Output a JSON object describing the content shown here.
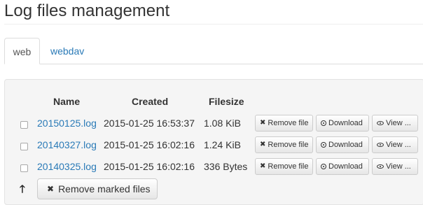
{
  "page": {
    "title": "Log files management"
  },
  "tabs": [
    {
      "label": "web",
      "active": true
    },
    {
      "label": "webdav",
      "active": false
    }
  ],
  "table": {
    "headers": {
      "name": "Name",
      "created": "Created",
      "filesize": "Filesize"
    },
    "rows": [
      {
        "name": "20150125.log",
        "created": "2015-01-25 16:53:37",
        "size": "1.08 KiB"
      },
      {
        "name": "20140327.log",
        "created": "2015-01-25 16:02:16",
        "size": "1.24 KiB"
      },
      {
        "name": "20140325.log",
        "created": "2015-01-25 16:02:16",
        "size": "336 Bytes"
      }
    ],
    "actions": {
      "remove": "Remove file",
      "download": "Download",
      "view": "View ..."
    }
  },
  "footer": {
    "remove_marked": "Remove marked files"
  },
  "icons": {
    "remove": "times-icon",
    "download": "download-icon",
    "view": "eye-icon",
    "up": "arrow-up-icon"
  },
  "colors": {
    "link": "#2a7ab7",
    "well": "#f5f5f5"
  }
}
